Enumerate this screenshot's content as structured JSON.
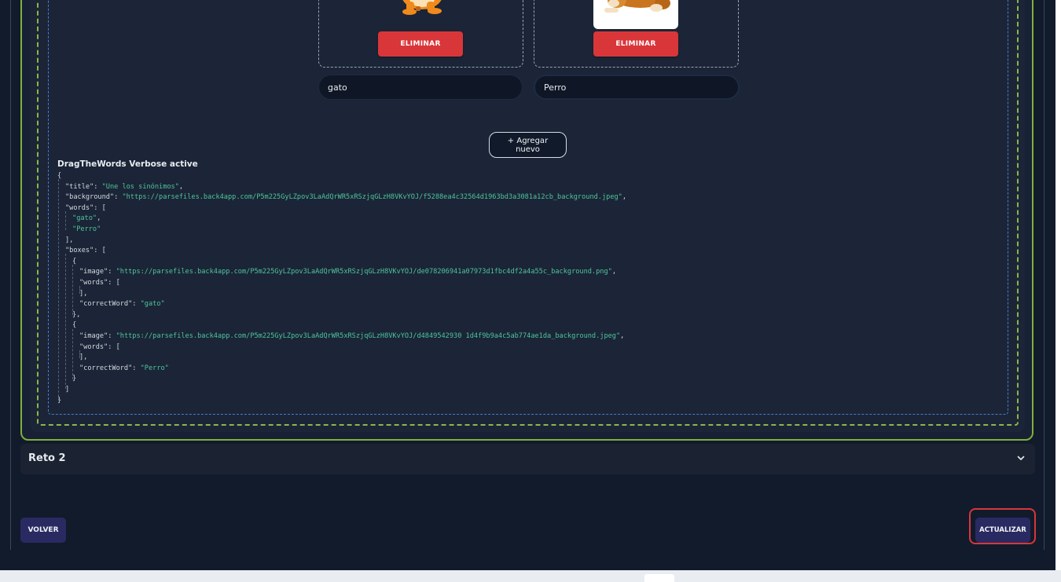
{
  "boxes": [
    {
      "image_desc": "cartoon orange cat",
      "delete_label": "ELIMINAR",
      "word": "gato"
    },
    {
      "image_desc": "cartoon brown dog",
      "delete_label": "ELIMINAR",
      "word": "Perro"
    }
  ],
  "add_button_label": "+ Agregar nuevo",
  "verbose": {
    "title": "DragTheWords Verbose active",
    "json": {
      "title": "Une los sinónimos",
      "background": "https://parsefiles.back4app.com/P5m225GyLZpov3LaAdQrWR5xRSzjqGLzH8VKvYOJ/f5288ea4c32564d1963bd3a3081a12cb_background.jpeg",
      "words": [
        "gato",
        "Perro"
      ],
      "boxes": [
        {
          "image": "https://parsefiles.back4app.com/P5m225GyLZpov3LaAdQrWR5xRSzjqGLzH8VKvYOJ/de078206941a07973d1fbc4df2a4a55c_background.png",
          "correctWord": "gato"
        },
        {
          "image": "https://parsefiles.back4app.com/P5m225GyLZpov3LaAdQrWR5xRSzjqGLzH8VKvYOJ/d4849542930 1d4f9b9a4c5ab774ae1da_background.jpeg",
          "correctWord": "Perro"
        }
      ]
    }
  },
  "reto2": {
    "title": "Reto 2",
    "icon": "chevron-down-icon"
  },
  "footer": {
    "back_label": "VOLVER",
    "update_label": "ACTUALIZAR"
  },
  "colors": {
    "danger": "#d9363a",
    "primary_dark": "#2a2a62",
    "json_string": "#4fc49a",
    "panel_border": "#7fae3e",
    "dashed_blue": "#4a7cc7"
  }
}
